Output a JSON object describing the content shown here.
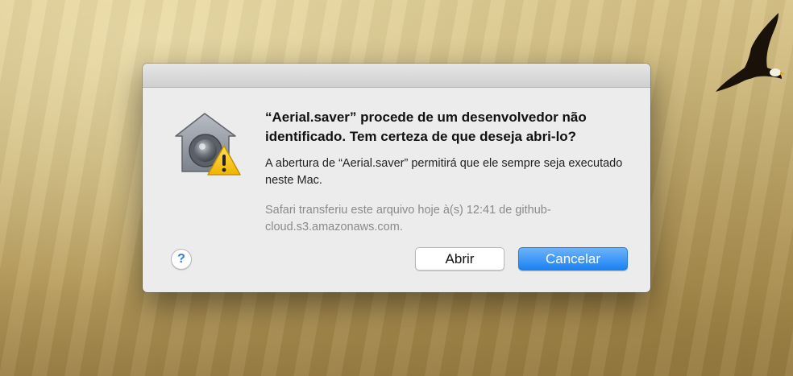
{
  "dialog": {
    "title": "“Aerial.saver” procede de um desenvolvedor não identificado. Tem certeza de que deseja abri-lo?",
    "body": "A abertura de “Aerial.saver” permitirá que ele sempre seja executado neste Mac.",
    "source": "Safari transferiu este arquivo hoje à(s) 12:41 de github-cloud.s3.amazonaws.com.",
    "help_label": "?",
    "open_label": "Abrir",
    "cancel_label": "Cancelar",
    "icon": "gatekeeper-warning-icon"
  },
  "colors": {
    "default_button": "#1a82f3",
    "warning": "#f5c400"
  }
}
